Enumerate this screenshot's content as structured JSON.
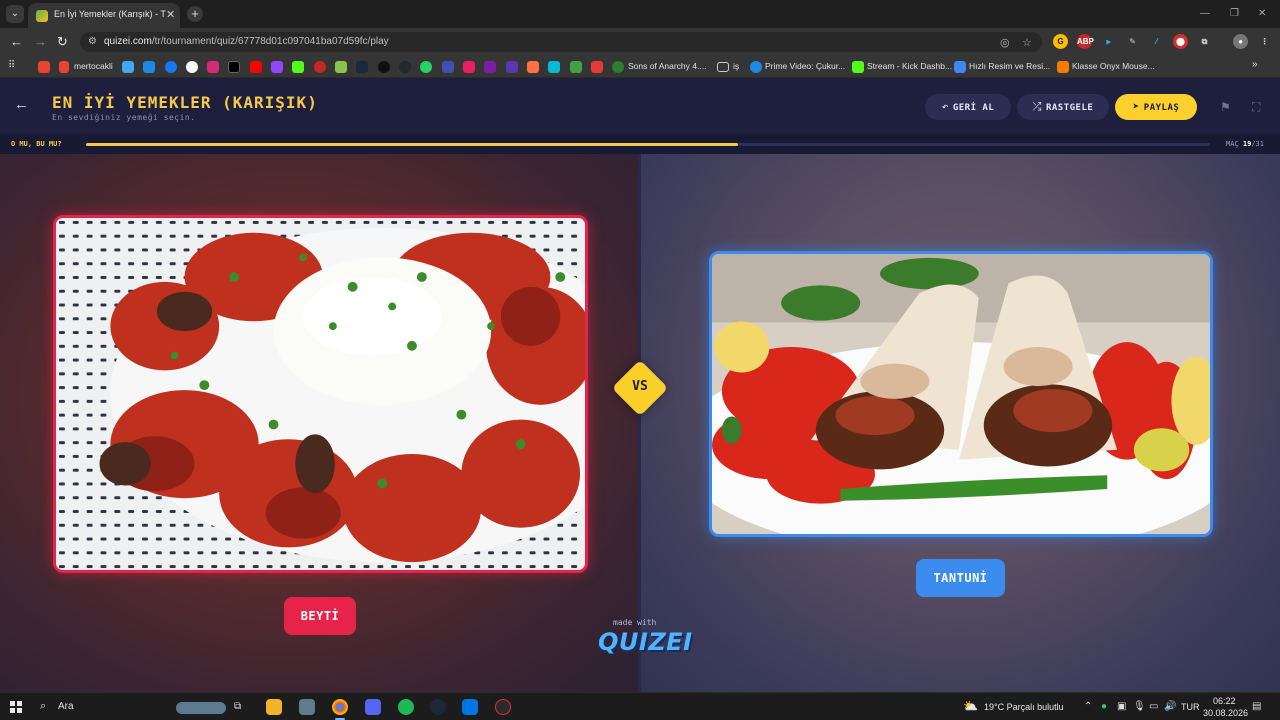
{
  "browser": {
    "tab_title": "En İyi Yemekler (Karışık) - Tier Li",
    "url_host": "quizei.com",
    "url_path": "/tr/tournament/quiz/67778d01c097041ba07d59fc/play",
    "bookmarks": [
      {
        "label": "mertocakli",
        "icon_color": "#ea4335"
      },
      {
        "label": "Sons of Anarchy 4....",
        "icon_color": "#2e7d32"
      },
      {
        "label": "iş",
        "icon_color": "#9e9e9e"
      },
      {
        "label": "Prime Video: Çukur...",
        "icon_color": "#1e88e5"
      },
      {
        "label": "Stream - Kick Dashb...",
        "icon_color": "#53fc18"
      },
      {
        "label": "Hızlı Resim ve Resi...",
        "icon_color": "#4285f4"
      },
      {
        "label": "Klasse Onyx Mouse...",
        "icon_color": "#f57c00"
      }
    ]
  },
  "header": {
    "title": "EN İYİ YEMEKLER (KARIŞIK)",
    "subtitle": "En sevdiğiniz yemeği seçin.",
    "undo_label": "GERİ AL",
    "random_label": "RASTGELE",
    "share_label": "PAYLAŞ"
  },
  "progress": {
    "label": "O MU, BU MU?",
    "match_prefix": "MAÇ",
    "current": "19",
    "total": "/31",
    "fraction": 0.58
  },
  "matchup": {
    "left_name": "BEYTİ",
    "right_name": "TANTUNİ",
    "vs": "VS",
    "made_with": "made with",
    "brand": "QUIZEI"
  },
  "colors": {
    "accent_yellow": "#f7c948",
    "left_red": "#e8234b",
    "right_blue": "#3c8cf0"
  },
  "taskbar": {
    "search_placeholder": "Ara",
    "weather": "19°C  Parçalı bulutlu",
    "lang": "TUR",
    "time": "06:22",
    "date": "30.08.2026"
  }
}
